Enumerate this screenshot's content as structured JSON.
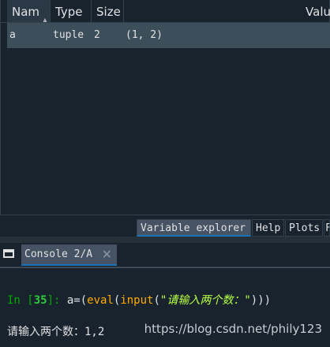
{
  "variable_explorer": {
    "columns": {
      "name": "Nam",
      "type": "Type",
      "size": "Size",
      "value": "Valu"
    },
    "rows": [
      {
        "name": "a",
        "type": "tuple",
        "size": "2",
        "value": "(1, 2)"
      }
    ]
  },
  "pane_tabs": [
    {
      "label": "Variable explorer",
      "active": true
    },
    {
      "label": "Help",
      "active": false
    },
    {
      "label": "Plots",
      "active": false
    },
    {
      "label": "F",
      "active": false
    }
  ],
  "console": {
    "tab_label": "Console 2/A",
    "close_glyph": "✕",
    "prompt_in": "In [",
    "prompt_number": "35",
    "prompt_end": "]: ",
    "code": {
      "assign": "a=(",
      "eval": "eval",
      "paren1": "(",
      "input": "input",
      "paren2": "(",
      "string": "\"请输入两个数：\"",
      "close": ")))"
    },
    "output": "请输入两个数：1,2"
  },
  "watermark": "https://blog.csdn.net/phily123",
  "colors": {
    "background": "#19232d",
    "selected_row": "#3d4e5b",
    "active_tab_underline": "#1a72bb",
    "prompt_green": "#00aa00",
    "builtin_orange": "#ffaa00",
    "string_green": "#b5ff44"
  }
}
